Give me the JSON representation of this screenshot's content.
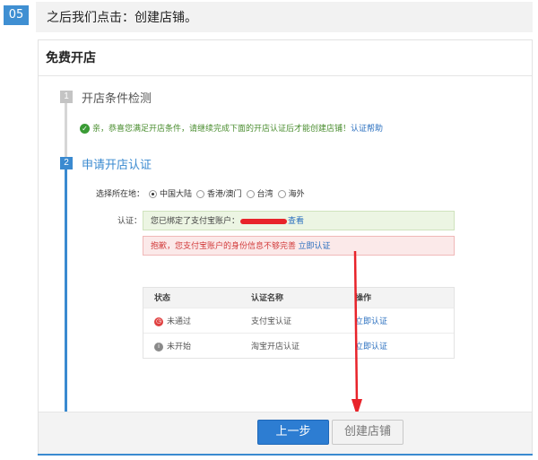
{
  "step_badge": "05",
  "instruction": "之后我们点击：创建店铺。",
  "panel": {
    "title": "免费开店",
    "step1": {
      "num": "1",
      "label": "开店条件检测"
    },
    "check_message": "亲，恭喜您满足开店条件，请继续完成下面的开店认证后才能创建店铺！",
    "check_link": "认证帮助",
    "step2": {
      "num": "2",
      "label": "申请开店认证"
    },
    "region": {
      "label": "选择所在地：",
      "options": [
        "中国大陆",
        "香港/澳门",
        "台湾",
        "海外"
      ],
      "selected": "中国大陆"
    },
    "auth_label": "认证：",
    "green_box": {
      "text": "您已绑定了支付宝账户：",
      "link": "查看"
    },
    "red_box": {
      "text": "抱歉，您支付宝账户的身份信息不够完善",
      "link": "立即认证"
    },
    "table": {
      "headers": [
        "状态",
        "认证名称",
        "操作"
      ],
      "rows": [
        {
          "status": "未通过",
          "name": "支付宝认证",
          "action": "立即认证"
        },
        {
          "status": "未开始",
          "name": "淘宝开店认证",
          "action": "立即认证"
        }
      ]
    },
    "buttons": {
      "prev": "上一步",
      "create": "创建店铺"
    }
  },
  "colors": {
    "accent": "#3a8ad0",
    "error": "#e04040",
    "success": "#3a9b35",
    "annotation_arrow": "#e8232a"
  }
}
